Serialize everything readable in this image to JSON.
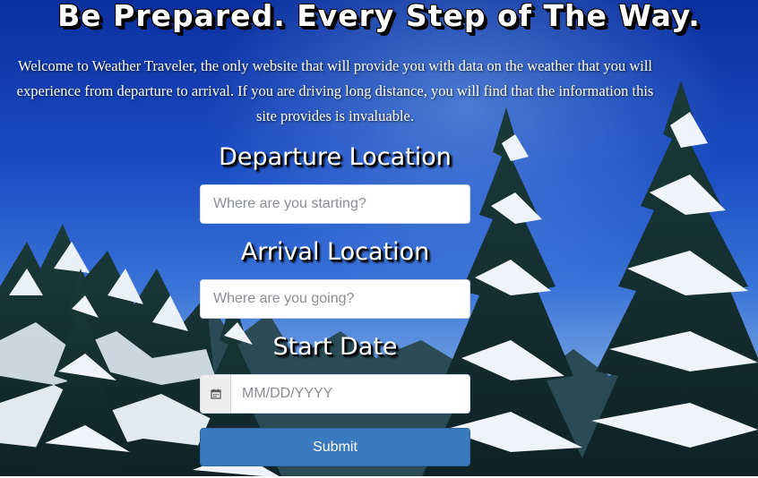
{
  "page": {
    "headline": "Be Prepared. Every Step of The Way.",
    "intro": "Welcome to Weather Traveler, the only website that will provide you with data on the weather that you will experience from departure to arrival. If you are driving long distance, you will find that the information this site provides is invaluable."
  },
  "form": {
    "departure_label": "Departure Location",
    "departure_placeholder": "Where are you starting?",
    "arrival_label": "Arrival Location",
    "arrival_placeholder": "Where are you going?",
    "date_label": "Start Date",
    "date_placeholder": "MM/DD/YYYY",
    "date_icon": "calendar-icon",
    "submit_label": "Submit"
  },
  "colors": {
    "submit_button": "#3b7abf",
    "sky_top": "#0c2f9e",
    "sky_bottom": "#9dbde6"
  }
}
